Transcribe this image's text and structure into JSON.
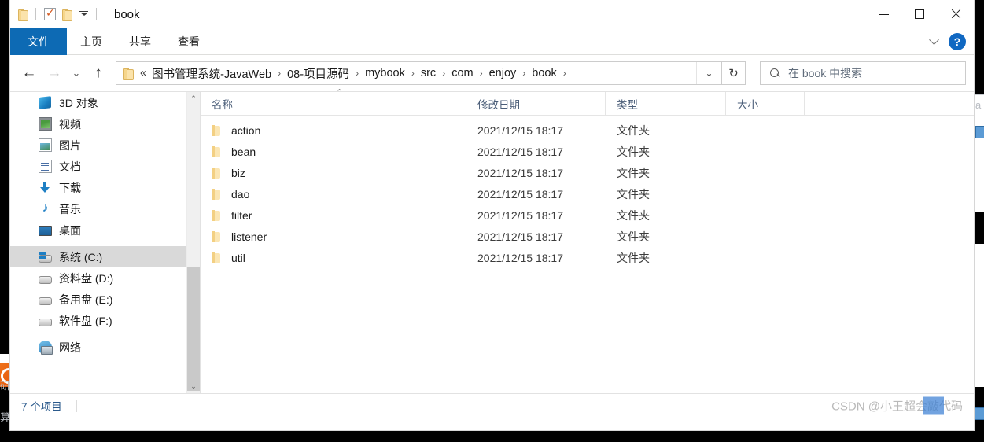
{
  "window": {
    "title": "book",
    "quick_access": [
      "folder-icon",
      "properties-icon",
      "new-folder-icon",
      "customize-caret"
    ],
    "controls": {
      "minimize": "—",
      "maximize": "□",
      "close": "✕"
    }
  },
  "ribbon": {
    "tabs": [
      {
        "label": "文件",
        "active": true
      },
      {
        "label": "主页",
        "active": false
      },
      {
        "label": "共享",
        "active": false
      },
      {
        "label": "查看",
        "active": false
      }
    ],
    "collapse_icon": "chevron-down-icon",
    "help_label": "?"
  },
  "address": {
    "back": "←",
    "forward": "→",
    "recent": "⌄",
    "up": "↑",
    "lead_separator": "«",
    "crumbs": [
      "图书管理系统-JavaWeb",
      "08-项目源码",
      "mybook",
      "src",
      "com",
      "enjoy",
      "book"
    ],
    "separator": "›",
    "dropdown_icon": "⌄",
    "refresh_icon": "↻"
  },
  "search": {
    "placeholder": "在 book 中搜索",
    "icon": "search-icon"
  },
  "sidebar": {
    "items": [
      {
        "label": "3D 对象",
        "icon": "3d-objects-icon",
        "selected": false
      },
      {
        "label": "视频",
        "icon": "videos-icon",
        "selected": false
      },
      {
        "label": "图片",
        "icon": "pictures-icon",
        "selected": false
      },
      {
        "label": "文档",
        "icon": "documents-icon",
        "selected": false
      },
      {
        "label": "下载",
        "icon": "downloads-icon",
        "selected": false
      },
      {
        "label": "音乐",
        "icon": "music-icon",
        "selected": false
      },
      {
        "label": "桌面",
        "icon": "desktop-icon",
        "selected": false
      },
      {
        "label": "系统 (C:)",
        "icon": "system-drive-icon",
        "selected": true
      },
      {
        "label": "资料盘 (D:)",
        "icon": "drive-icon",
        "selected": false
      },
      {
        "label": "备用盘 (E:)",
        "icon": "drive-icon",
        "selected": false
      },
      {
        "label": "软件盘 (F:)",
        "icon": "drive-icon",
        "selected": false
      },
      {
        "label": "网络",
        "icon": "network-icon",
        "selected": false
      }
    ],
    "scroll_up_icon": "⌃",
    "scroll_down_icon": "⌄"
  },
  "columns": {
    "name": "名称",
    "date": "修改日期",
    "type": "类型",
    "size": "大小",
    "sort_indicator": "⌃"
  },
  "files": [
    {
      "name": "action",
      "date": "2021/12/15 18:17",
      "type": "文件夹",
      "size": ""
    },
    {
      "name": "bean",
      "date": "2021/12/15 18:17",
      "type": "文件夹",
      "size": ""
    },
    {
      "name": "biz",
      "date": "2021/12/15 18:17",
      "type": "文件夹",
      "size": ""
    },
    {
      "name": "dao",
      "date": "2021/12/15 18:17",
      "type": "文件夹",
      "size": ""
    },
    {
      "name": "filter",
      "date": "2021/12/15 18:17",
      "type": "文件夹",
      "size": ""
    },
    {
      "name": "listener",
      "date": "2021/12/15 18:17",
      "type": "文件夹",
      "size": ""
    },
    {
      "name": "util",
      "date": "2021/12/15 18:17",
      "type": "文件夹",
      "size": ""
    }
  ],
  "status": {
    "item_count": "7 个项目"
  },
  "watermark": {
    "text": "CSDN @小王超会敲代码"
  },
  "colors": {
    "accent_blue": "#0d6ab4",
    "selection_gray": "#d9d9d9",
    "header_text": "#4a5d78",
    "folder_yellow": "#fbe6b4"
  }
}
